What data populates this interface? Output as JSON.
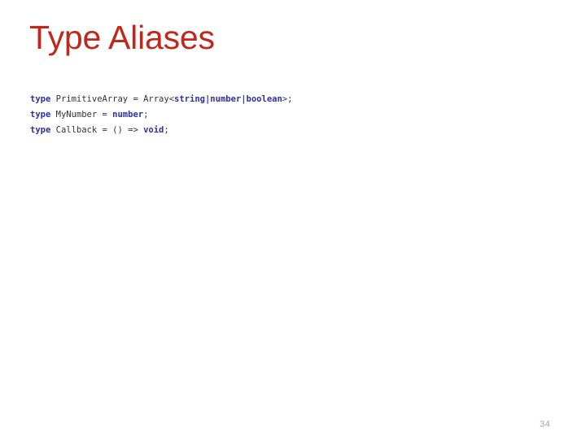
{
  "slide": {
    "title": "Type Aliases",
    "page_number": "34",
    "background_color": "#ffffff",
    "title_color": "#c0281c",
    "keyword_color": "#2f2fa8",
    "text_color": "#333333",
    "page_number_color": "#a6a6a6"
  },
  "code": {
    "language": "typescript",
    "lines": [
      {
        "text": "type PrimitiveArray = Array<string|number|boolean>;",
        "tokens": [
          {
            "t": "type",
            "k": "kw"
          },
          {
            "t": " PrimitiveArray = Array",
            "k": "plain"
          },
          {
            "t": "<",
            "k": "punct"
          },
          {
            "t": "string|number|boolean",
            "k": "type"
          },
          {
            "t": ">;",
            "k": "punct"
          }
        ]
      },
      {
        "text": "type MyNumber = number;",
        "tokens": [
          {
            "t": "type",
            "k": "kw"
          },
          {
            "t": " MyNumber = ",
            "k": "plain"
          },
          {
            "t": "number",
            "k": "type"
          },
          {
            "t": ";",
            "k": "punct"
          }
        ]
      },
      {
        "text": "type Callback = () => void;",
        "tokens": [
          {
            "t": "type",
            "k": "kw"
          },
          {
            "t": " Callback = () => ",
            "k": "plain"
          },
          {
            "t": "void",
            "k": "type"
          },
          {
            "t": ";",
            "k": "punct"
          }
        ]
      }
    ]
  }
}
